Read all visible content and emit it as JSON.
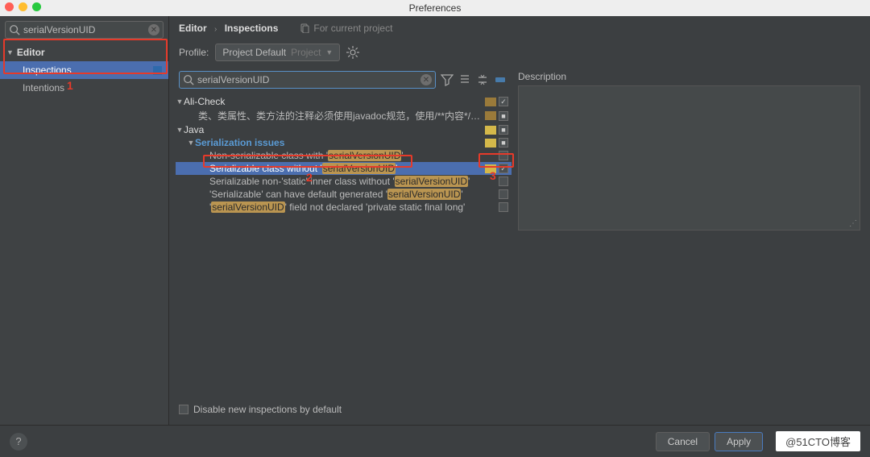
{
  "window": {
    "title": "Preferences"
  },
  "sidebar": {
    "search": {
      "value": "serialVersionUID",
      "placeholder": ""
    },
    "category": "Editor",
    "items": [
      {
        "label": "Inspections",
        "selected": true,
        "badge": true
      },
      {
        "label": "Intentions",
        "selected": false,
        "badge": false
      }
    ]
  },
  "breadcrumb": {
    "root": "Editor",
    "current": "Inspections"
  },
  "forProject": "For current project",
  "profile": {
    "label": "Profile:",
    "value": "Project Default",
    "suffix": "Project"
  },
  "mainSearch": {
    "value": "serialVersionUID"
  },
  "tree": {
    "groups": [
      {
        "name": "Ali-Check",
        "severity": "brown",
        "checked": true,
        "items": [
          {
            "text": "类、类属性、类方法的注释必须使用javadoc规范，使用/**内容*/格式，不...",
            "severity": "brown",
            "checkedIndeterminate": true
          }
        ]
      },
      {
        "name": "Java",
        "severity": "yellow",
        "checkedIndeterminate": true,
        "subgroups": [
          {
            "name": "Serialization issues",
            "severity": "yellow",
            "checkedIndeterminate": true,
            "items": [
              {
                "prefix": "Non-serializable class with '",
                "hl": "serialVersionUID",
                "suffix": "'",
                "checked": false
              },
              {
                "prefix": "Serializable class without '",
                "hl": "serialVersionUID",
                "suffix": "'",
                "checked": true,
                "severity": "yellow",
                "selected": true
              },
              {
                "prefix": "Serializable non-'static' inner class without '",
                "hl": "serialVersionUID",
                "suffix": "'",
                "checked": false
              },
              {
                "prefix": "'Serializable' can have default generated '",
                "hl": "serialVersionUID",
                "suffix": "'",
                "checked": false
              },
              {
                "prefix": "'",
                "hl": "serialVersionUID",
                "suffix": "' field not declared 'private static final long'",
                "checked": false
              }
            ]
          }
        ]
      }
    ]
  },
  "description": {
    "label": "Description"
  },
  "disableNew": {
    "label": "Disable new inspections by default",
    "checked": false
  },
  "footer": {
    "cancel": "Cancel",
    "apply": "Apply"
  },
  "annotations": {
    "n1": "1",
    "n2": "2",
    "n3": "3"
  },
  "watermark": "@51CTO博客"
}
